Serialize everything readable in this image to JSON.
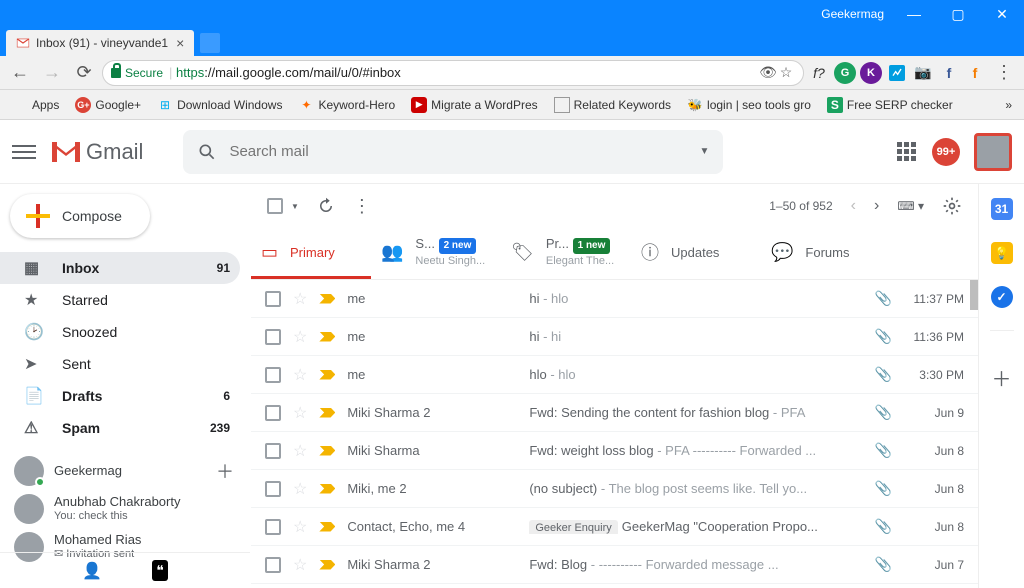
{
  "window": {
    "title": "Geekermag"
  },
  "tab": {
    "title": "Inbox (91) - vineyvande1"
  },
  "url": {
    "secure_label": "Secure",
    "prefix": "https",
    "rest": "://mail.google.com/mail/u/0/#inbox"
  },
  "ext": {
    "f_text": "f?",
    "g": "G",
    "k": "K",
    "f1": "f",
    "f2": "f",
    "seo": "S"
  },
  "bookmarks": {
    "apps": "Apps",
    "gplus": "Google+",
    "dlwin": "Download Windows",
    "khero": "Keyword-Hero",
    "migrate": "Migrate a WordPres",
    "related": "Related Keywords",
    "login": "login | seo tools gro",
    "serp": "Free SERP checker"
  },
  "gmail": {
    "brand": "Gmail",
    "search_placeholder": "Search mail",
    "notif_count": "99+",
    "compose": "Compose",
    "pager": "1–50 of 952"
  },
  "sidebar": {
    "inbox": {
      "label": "Inbox",
      "count": "91"
    },
    "starred": {
      "label": "Starred"
    },
    "snoozed": {
      "label": "Snoozed"
    },
    "sent": {
      "label": "Sent"
    },
    "drafts": {
      "label": "Drafts",
      "count": "6"
    },
    "spam": {
      "label": "Spam",
      "count": "239"
    },
    "chat": [
      {
        "name": "Geekermag",
        "sub": ""
      },
      {
        "name": "Anubhab Chakraborty",
        "sub": "You: check this"
      },
      {
        "name": "Mohamed Rias",
        "sub": "✉ Invitation sent"
      }
    ]
  },
  "tabs": {
    "primary": "Primary",
    "social": {
      "label": "S...",
      "sub": "Neetu Singh...",
      "badge": "2 new"
    },
    "promotions": {
      "label": "Pr...",
      "sub": "Elegant The...",
      "badge": "1 new"
    },
    "updates": "Updates",
    "forums": "Forums"
  },
  "mail": [
    {
      "sender": "me",
      "subject": "hi",
      "snippet": " - hlo",
      "date": "11:37 PM",
      "attach": true
    },
    {
      "sender": "me",
      "subject": "hi",
      "snippet": " - hi",
      "date": "11:36 PM",
      "attach": true
    },
    {
      "sender": "me",
      "subject": "hlo",
      "snippet": " - hlo",
      "date": "3:30 PM",
      "attach": true
    },
    {
      "sender": "Miki Sharma 2",
      "subject": "Fwd: Sending the content for fashion blog",
      "snippet": " - PFA",
      "date": "Jun 9",
      "attach": true
    },
    {
      "sender": "Miki Sharma",
      "subject": "Fwd: weight loss blog",
      "snippet": " - PFA ---------- Forwarded ...",
      "date": "Jun 8",
      "attach": true
    },
    {
      "sender": "Miki, me 2",
      "subject": "(no subject)",
      "snippet": " - The blog post seems like. Tell yo...",
      "date": "Jun 8",
      "attach": true
    },
    {
      "sender": "Contact, Echo, me 4",
      "subject": "GeekerMag \"Cooperation Propo...",
      "snippet": "",
      "date": "Jun 8",
      "tag": "Geeker Enquiry",
      "attach": true
    },
    {
      "sender": "Miki Sharma 2",
      "subject": "Fwd: Blog",
      "snippet": " - ---------- Forwarded message ...",
      "date": "Jun 7",
      "attach": true
    }
  ],
  "sidepanel": {
    "cal": "31"
  }
}
